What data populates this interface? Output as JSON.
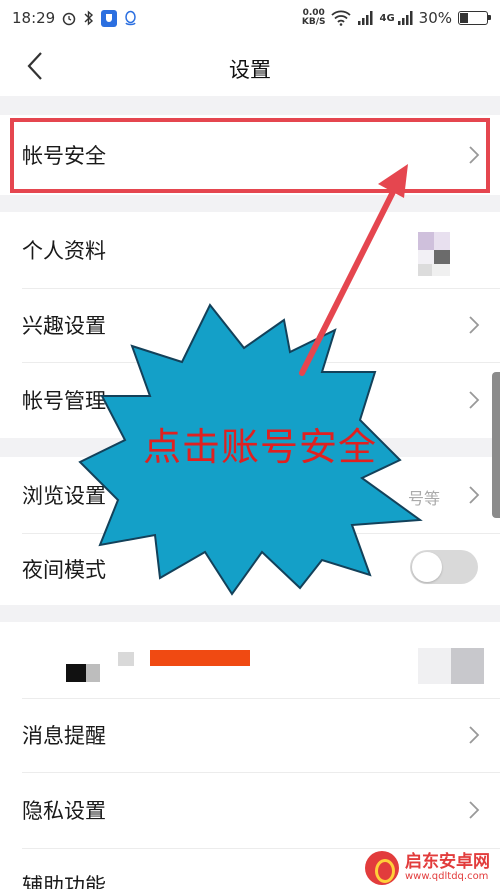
{
  "status_bar": {
    "time": "18:29",
    "net_speed_value": "0.00",
    "net_speed_unit": "KB/S",
    "network_type": "4G",
    "battery_percent": "30%",
    "battery_level": 0.3
  },
  "nav": {
    "title": "设置"
  },
  "groups": {
    "account_security": {
      "label": "帐号安全"
    },
    "profile": {
      "label": "个人资料"
    },
    "interest": {
      "label": "兴趣设置"
    },
    "account_manage": {
      "label": "帐号管理"
    },
    "browse": {
      "label": "浏览设置",
      "subtitle": "号等"
    },
    "night_mode": {
      "label": "夜间模式",
      "enabled": false
    },
    "notifications": {
      "label": "消息提醒"
    },
    "privacy": {
      "label": "隐私设置"
    },
    "accessibility": {
      "label": "辅助功能"
    }
  },
  "annotation": {
    "callout": "点击账号安全",
    "colors": {
      "callout_fill": "#14a0c8",
      "arrow": "#e5464f",
      "text": "#e02020"
    }
  },
  "watermark": {
    "name": "启东安卓网",
    "url": "www.qdltdq.com"
  }
}
